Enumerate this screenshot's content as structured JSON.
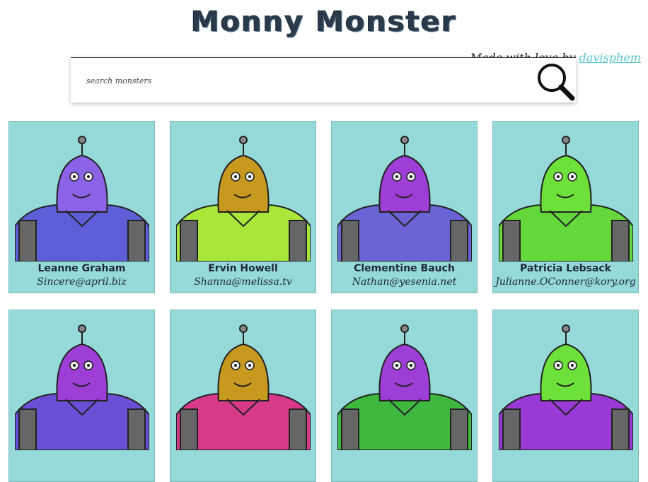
{
  "header": {
    "title": "Monny Monster",
    "credit_prefix": "Made with love by",
    "credit_link": "davisphem"
  },
  "search": {
    "placeholder": "search monsters"
  },
  "colors": {
    "card_bg": "#95d9d8",
    "link": "#58c6cc"
  },
  "monsters": [
    {
      "name": "Leanne Graham",
      "email": "Sincere@april.biz",
      "head": "#8a63e6",
      "body": "#5e5fd8"
    },
    {
      "name": "Ervin Howell",
      "email": "Shanna@melissa.tv",
      "head": "#c79a1f",
      "body": "#a8e63a"
    },
    {
      "name": "Clementine Bauch",
      "email": "Nathan@yesenia.net",
      "head": "#9d3fd6",
      "body": "#6a63d6"
    },
    {
      "name": "Patricia Lebsack",
      "email": "Julianne.OConner@kory.org",
      "head": "#6de03a",
      "body": "#64d83a"
    },
    {
      "name": "",
      "email": "",
      "head": "#9d3fd6",
      "body": "#6a4fd6"
    },
    {
      "name": "",
      "email": "",
      "head": "#c79a1f",
      "body": "#d83a8a"
    },
    {
      "name": "",
      "email": "",
      "head": "#9d3fd6",
      "body": "#3fb83f"
    },
    {
      "name": "",
      "email": "",
      "head": "#6de03a",
      "body": "#9a3ad6"
    }
  ]
}
